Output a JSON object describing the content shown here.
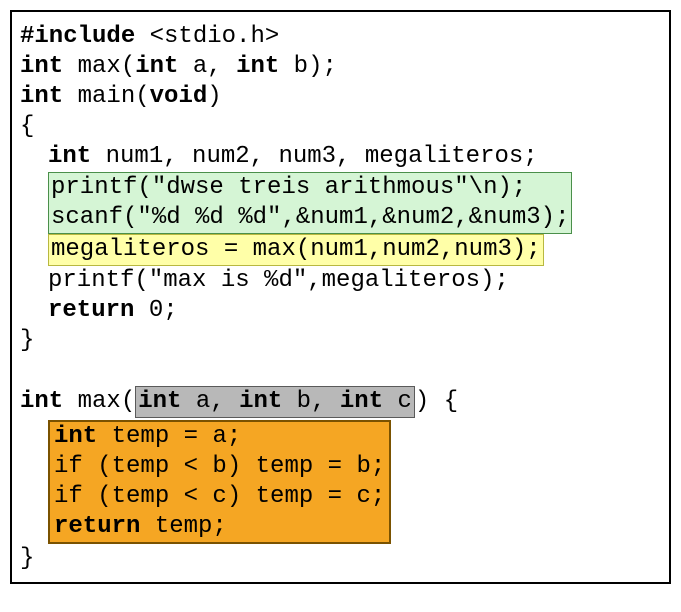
{
  "code": {
    "l1": {
      "a": "#include",
      "b": " <stdio.h>"
    },
    "l2": {
      "a": "int",
      "b": " max(",
      "c": "int",
      "d": " a, ",
      "e": "int",
      "f": " b);"
    },
    "l3": {
      "a": "int",
      "b": " main(",
      "c": "void",
      "d": ")"
    },
    "l4": "{",
    "l5": {
      "a": "int",
      "b": " num1, num2, num3, megaliteros;"
    },
    "l6": "printf(\"dwse treis arithmous\"\\n);",
    "l7": "scanf(\"%d %d %d\",&num1,&num2,&num3);",
    "l8": "megaliteros = max(num1,num2,num3);",
    "l9": "printf(\"max is %d\",megaliteros);",
    "l10": {
      "a": "return",
      "b": " 0;"
    },
    "l11": "}",
    "l12": {
      "a": "int",
      "b": " max(",
      "c1": "int",
      "c2": " a, ",
      "c3": "int",
      "c4": " b, ",
      "c5": "int",
      "c6": " c",
      "d": ") {"
    },
    "l13": {
      "a": "int",
      "b": " temp = a;"
    },
    "l14": "if (temp < b) temp = b;",
    "l15": "if (temp < c) temp = c;",
    "l16": {
      "a": "return",
      "b": " temp;"
    },
    "l17": "}"
  }
}
